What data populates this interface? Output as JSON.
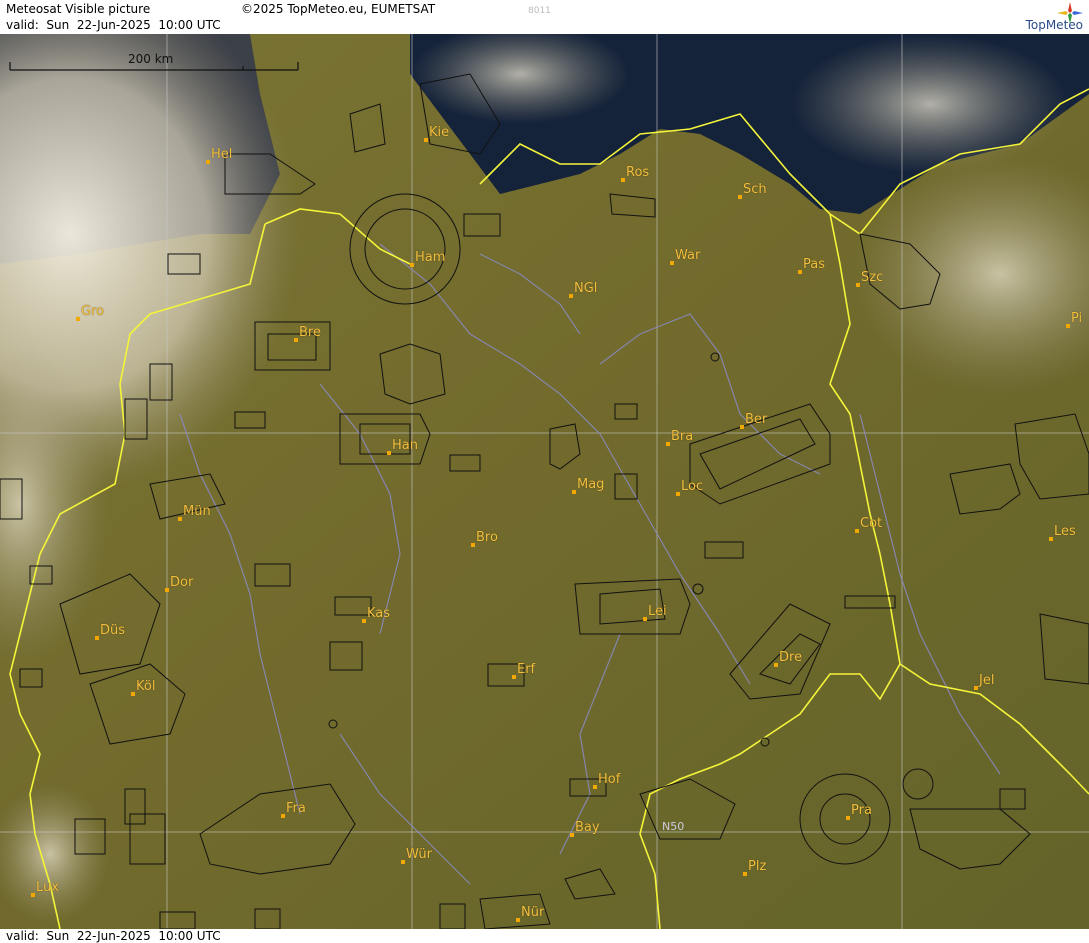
{
  "header": {
    "title": "Meteosat Visible picture",
    "valid": "valid:  Sun  22-Jun-2025  10:00 UTC",
    "copyright": "©2025 TopMeteo.eu, EUMETSAT",
    "code": "8011",
    "logo": "TopMeteo"
  },
  "footer": {
    "valid": "valid:  Sun  22-Jun-2025  10:00 UTC"
  },
  "map": {
    "scale_label": "200 km",
    "grid_label": "N50",
    "cities": [
      {
        "id": "kie",
        "name": "Kie"
      },
      {
        "id": "hel",
        "name": "Hel"
      },
      {
        "id": "ros",
        "name": "Ros"
      },
      {
        "id": "sch",
        "name": "Sch"
      },
      {
        "id": "ham",
        "name": "Ham"
      },
      {
        "id": "war",
        "name": "War"
      },
      {
        "id": "pas",
        "name": "Pas"
      },
      {
        "id": "szc",
        "name": "Szc"
      },
      {
        "id": "ngl",
        "name": "NGl"
      },
      {
        "id": "gro",
        "name": "Gro"
      },
      {
        "id": "bre",
        "name": "Bre"
      },
      {
        "id": "pi",
        "name": "Pi"
      },
      {
        "id": "ber",
        "name": "Ber"
      },
      {
        "id": "bra",
        "name": "Bra"
      },
      {
        "id": "han",
        "name": "Han"
      },
      {
        "id": "mag",
        "name": "Mag"
      },
      {
        "id": "loc",
        "name": "Loc"
      },
      {
        "id": "mun",
        "name": "Mün"
      },
      {
        "id": "cot",
        "name": "Cot"
      },
      {
        "id": "les",
        "name": "Les"
      },
      {
        "id": "bro",
        "name": "Bro"
      },
      {
        "id": "dor",
        "name": "Dor"
      },
      {
        "id": "kas",
        "name": "Kas"
      },
      {
        "id": "lei",
        "name": "Lei"
      },
      {
        "id": "dus",
        "name": "Düs"
      },
      {
        "id": "dre",
        "name": "Dre"
      },
      {
        "id": "erf",
        "name": "Erf"
      },
      {
        "id": "kol",
        "name": "Köl"
      },
      {
        "id": "jel",
        "name": "Jel"
      },
      {
        "id": "hof",
        "name": "Hof"
      },
      {
        "id": "fra",
        "name": "Fra"
      },
      {
        "id": "pra",
        "name": "Pra"
      },
      {
        "id": "bay",
        "name": "Bay"
      },
      {
        "id": "wur",
        "name": "Wür"
      },
      {
        "id": "plz",
        "name": "Plz"
      },
      {
        "id": "lux",
        "name": "Lux"
      },
      {
        "id": "nur",
        "name": "Nür"
      }
    ]
  },
  "colors": {
    "land": "#6f6a2c",
    "sea": "#14223a",
    "cloud": "#ece6d6",
    "border": "#f4f43a",
    "city": "#f2c040",
    "river": "#8c8ccc",
    "grid": "#c8c8c8"
  }
}
